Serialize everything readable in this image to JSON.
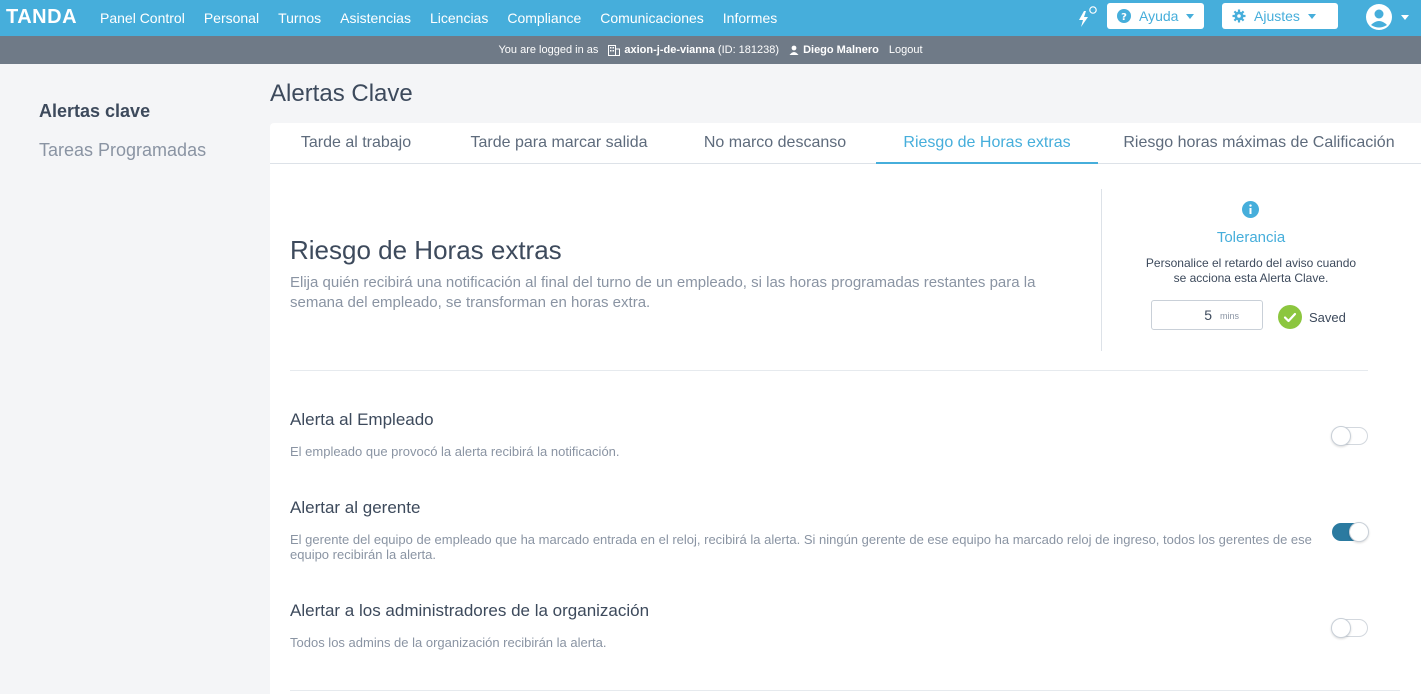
{
  "brand": {
    "logo": "TANDA",
    "accent": "#46aedb",
    "subbar": "#6f7a87"
  },
  "nav": {
    "links": [
      "Panel Control",
      "Personal",
      "Turnos",
      "Asistencias",
      "Licencias",
      "Compliance",
      "Comunicaciones",
      "Informes"
    ],
    "help_label": "Ayuda",
    "settings_label": "Ajustes"
  },
  "logbar": {
    "prefix": "You are logged in as",
    "org": "axion-j-de-vianna",
    "org_id": "(ID: 181238)",
    "user": "Diego Malnero",
    "logout": "Logout"
  },
  "sidebar": {
    "items": [
      {
        "label": "Alertas clave",
        "active": true
      },
      {
        "label": "Tareas Programadas",
        "active": false
      }
    ]
  },
  "page": {
    "title": "Alertas Clave"
  },
  "tabs": [
    {
      "label": "Tarde al trabajo",
      "active": false
    },
    {
      "label": "Tarde para marcar salida",
      "active": false
    },
    {
      "label": "No marco descanso",
      "active": false
    },
    {
      "label": "Riesgo de Horas extras",
      "active": true
    },
    {
      "label": "Riesgo horas máximas de Calificación",
      "active": false
    }
  ],
  "section": {
    "title": "Riesgo de Horas extras",
    "description": "Elija quién recibirá una notificación al final del turno de un empleado, si las horas programadas restantes para la semana del empleado, se transforman en horas extra."
  },
  "tolerance": {
    "title": "Tolerancia",
    "description": "Personalice el retardo del aviso cuando se acciona esta Alerta Clave.",
    "value": "5",
    "unit": "mins",
    "status": "Saved",
    "status_color": "#8cc63f"
  },
  "options": [
    {
      "title": "Alerta al Empleado",
      "description": "El empleado que provocó la alerta recibirá la notificación.",
      "enabled": false
    },
    {
      "title": "Alertar al gerente",
      "description": "El gerente del equipo de empleado que ha marcado entrada en el reloj, recibirá la alerta. Si ningún gerente de ese equipo ha marcado reloj de ingreso, todos los gerentes de ese equipo recibirán la alerta.",
      "enabled": true
    },
    {
      "title": "Alertar a los administradores de la organización",
      "description": "Todos los admins de la organización recibirán la alerta.",
      "enabled": false
    }
  ]
}
